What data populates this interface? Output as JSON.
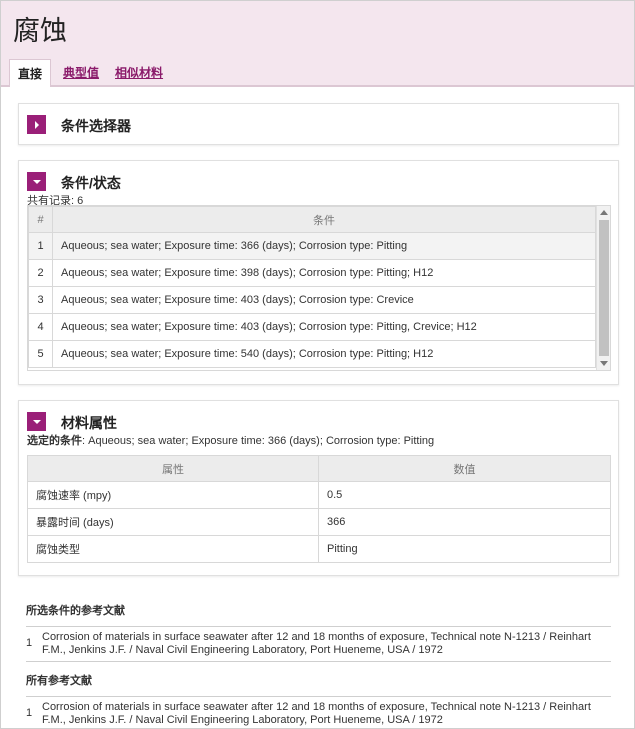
{
  "page": {
    "title": "腐蚀"
  },
  "tabs": [
    {
      "label": "直接",
      "active": true
    },
    {
      "label": "典型值",
      "active": false
    },
    {
      "label": "相似材料",
      "active": false
    }
  ],
  "condition_selector": {
    "title": "条件选择器"
  },
  "conditions": {
    "title": "条件/状态",
    "record_label": "共有记录: 6",
    "columns": [
      "#",
      "条件"
    ],
    "rows": [
      {
        "num": "1",
        "text": "Aqueous; sea water; Exposure time: 366 (days); Corrosion type: Pitting"
      },
      {
        "num": "2",
        "text": "Aqueous; sea water; Exposure time: 398 (days); Corrosion type: Pitting; H12"
      },
      {
        "num": "3",
        "text": "Aqueous; sea water; Exposure time: 403 (days); Corrosion type: Crevice"
      },
      {
        "num": "4",
        "text": "Aqueous; sea water; Exposure time: 403 (days); Corrosion type: Pitting, Crevice; H12"
      },
      {
        "num": "5",
        "text": "Aqueous; sea water; Exposure time: 540 (days); Corrosion type: Pitting; H12"
      }
    ]
  },
  "properties": {
    "title": "材料属性",
    "selected_label": "选定的条件",
    "selected_value": ": Aqueous; sea water; Exposure time: 366 (days); Corrosion type: Pitting",
    "columns": [
      "属性",
      "数值"
    ],
    "rows": [
      {
        "name": "腐蚀速率 (mpy)",
        "value": "0.5"
      },
      {
        "name": "暴露时间 (days)",
        "value": "366"
      },
      {
        "name": "腐蚀类型",
        "value": "Pitting"
      }
    ]
  },
  "selected_refs": {
    "title": "所选条件的参考文献",
    "items": [
      {
        "num": "1",
        "text": "Corrosion of materials in surface seawater after 12 and 18 months of exposure, Technical note N-1213 / Reinhart F.M., Jenkins J.F. / Naval Civil Engineering Laboratory, Port Hueneme, USA / 1972"
      }
    ]
  },
  "all_refs": {
    "title": "所有参考文献",
    "items": [
      {
        "num": "1",
        "text": "Corrosion of materials in surface seawater after 12 and 18 months of exposure, Technical note N-1213 / Reinhart F.M., Jenkins J.F. / Naval Civil Engineering Laboratory, Port Hueneme, USA / 1972"
      }
    ]
  }
}
